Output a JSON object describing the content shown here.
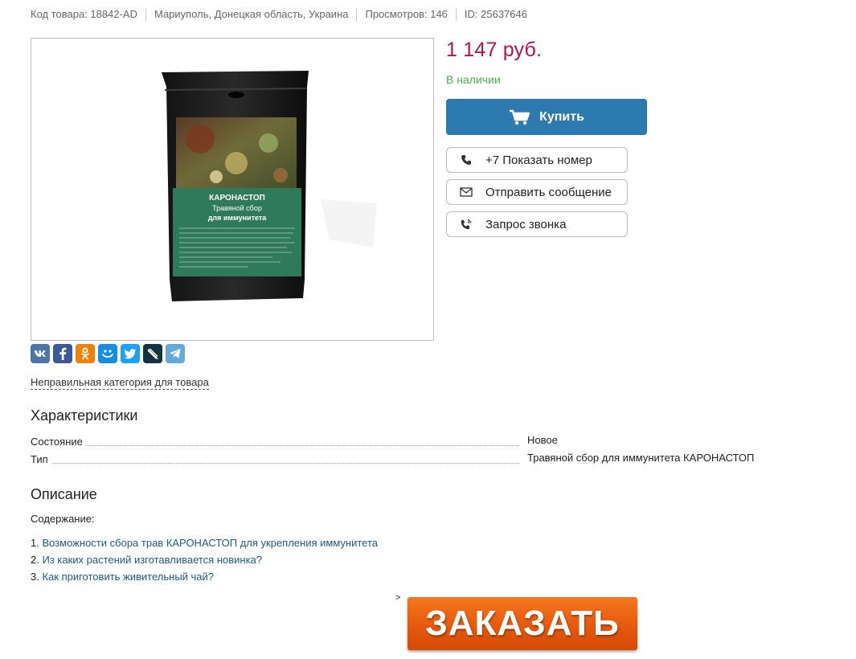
{
  "meta": {
    "code": "Код товара: 18842-AD",
    "location": "Мариуполь, Донецкая область, Украина",
    "views": "Просмотров: 146",
    "id": "ID: 25637646"
  },
  "product": {
    "package_title": "КАРОНАСТОП",
    "package_subtitle_1": "Травяной сбор",
    "package_subtitle_2": "для иммунитета"
  },
  "price": "1 147 руб.",
  "availability": "В наличии",
  "buy_label": "Купить",
  "contacts": {
    "phone": "+7 Показать номер",
    "message": "Отправить сообщение",
    "callback": "Запрос звонка"
  },
  "share": [
    {
      "icon": "vk-icon",
      "color": "#4a76a8"
    },
    {
      "icon": "facebook-icon",
      "color": "#3b5998"
    },
    {
      "icon": "odnoklassniki-icon",
      "color": "#ee8208"
    },
    {
      "icon": "moimir-icon",
      "color": "#168de2"
    },
    {
      "icon": "twitter-icon",
      "color": "#1da1f2"
    },
    {
      "icon": "livejournal-icon",
      "color": "#13343f"
    },
    {
      "icon": "telegram-icon",
      "color": "#64a9dc"
    }
  ],
  "wrong_category": "Неправильная категория для товара",
  "characteristics": {
    "title": "Характеристики",
    "rows": [
      {
        "label": "Состояние",
        "value": "Новое"
      },
      {
        "label": "Тип",
        "value": "Травяной сбор для иммунитета КАРОНАСТОП"
      }
    ]
  },
  "description": {
    "title": "Описание",
    "toc_label": "Содержание:",
    "toc": [
      {
        "num": "1.",
        "text": "Возможности сбора трав КАРОНАСТОП для укрепления иммунитета"
      },
      {
        "num": "2.",
        "text": "Из каких растений изготавливается новинка?"
      },
      {
        "num": "3.",
        "text": "Как приготовить живительный чай?"
      }
    ]
  },
  "gt_mark": ">",
  "order_label": "ЗАКАЗАТЬ",
  "colors": {
    "price": "#b5124f",
    "availability": "#4caf50",
    "buy_button": "#2d7ab0",
    "order_button": "#e4560c",
    "link": "#1d5a86"
  }
}
